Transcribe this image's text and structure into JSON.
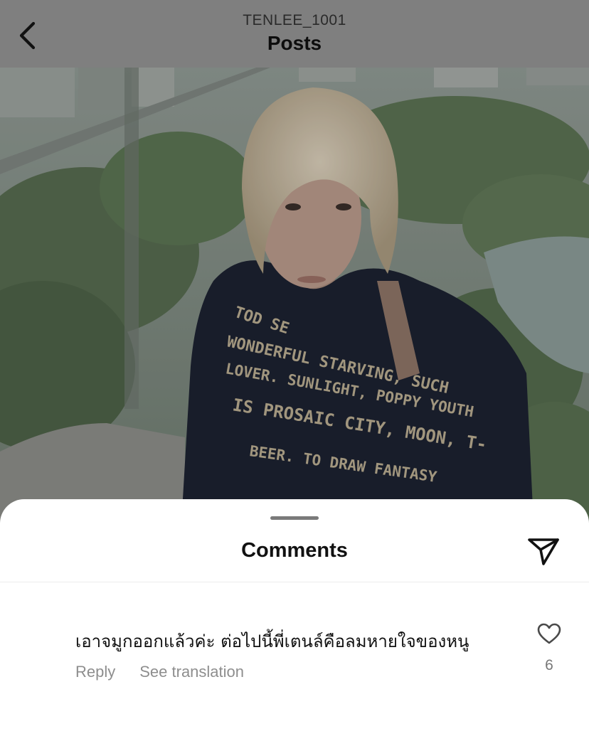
{
  "header": {
    "back_icon": "chevron-left-icon",
    "username": "TENLEE_1001",
    "title": "Posts"
  },
  "post": {
    "image": "photo of a person with light blond hair in a navy sweatshirt printed with handwritten-style text, in front of a window overlooking a park and city",
    "sweater_text": [
      "TOD SE",
      "WONDERFUL STARVING, SUCH",
      "LOVER. SUNLIGHT, POPPY YOUTH",
      "IS PROSAIC CITY, MOON, T-",
      "BEER. TO DRAW FANTASY"
    ]
  },
  "comments_sheet": {
    "title": "Comments",
    "share_icon": "send-icon",
    "comments": [
      {
        "text": "เอาจมูกออกแล้วค่ะ ต่อไปนี้พี่เตนล์คือลมหายใจของหนู",
        "reply_label": "Reply",
        "translate_label": "See translation",
        "like_icon": "heart-icon",
        "like_count": "6"
      }
    ]
  },
  "colors": {
    "header_dim": "#7f7f7f",
    "sheet_bg": "#ffffff",
    "secondary_text": "#8e8e8e"
  }
}
